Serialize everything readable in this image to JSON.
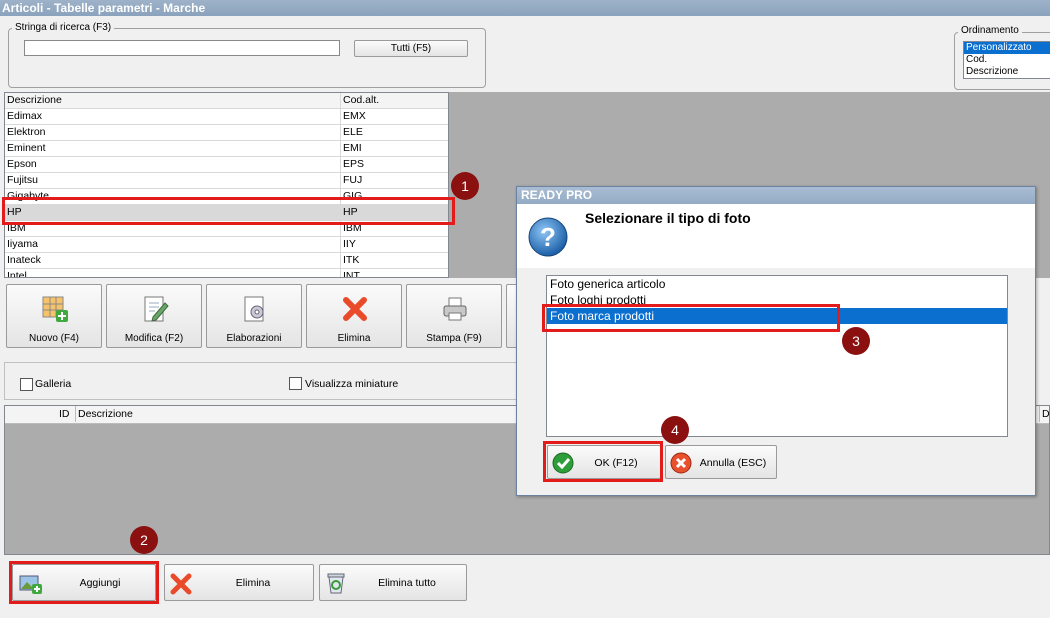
{
  "window": {
    "title": "Articoli - Tabelle parametri - Marche"
  },
  "search": {
    "legend": "Stringa di ricerca (F3)",
    "value": "",
    "all_button": "Tutti (F5)"
  },
  "ordering": {
    "legend": "Ordinamento",
    "options": [
      "Personalizzato",
      "Cod.",
      "Descrizione"
    ]
  },
  "brands": {
    "headers": [
      "Descrizione",
      "Cod.alt."
    ],
    "rows": [
      {
        "desc": "Edimax",
        "code": "EMX"
      },
      {
        "desc": "Elektron",
        "code": "ELE"
      },
      {
        "desc": "Eminent",
        "code": "EMI"
      },
      {
        "desc": "Epson",
        "code": "EPS"
      },
      {
        "desc": "Fujitsu",
        "code": "FUJ"
      },
      {
        "desc": "Gigabyte",
        "code": "GIG"
      },
      {
        "desc": "HP",
        "code": "HP"
      },
      {
        "desc": "IBM",
        "code": "IBM"
      },
      {
        "desc": "Iiyama",
        "code": "IIY"
      },
      {
        "desc": "Inateck",
        "code": "ITK"
      },
      {
        "desc": "Intel",
        "code": "INT"
      }
    ]
  },
  "toolbar": {
    "new": "Nuovo (F4)",
    "edit": "Modifica (F2)",
    "process": "Elaborazioni",
    "delete": "Elimina",
    "print": "Stampa (F9)"
  },
  "options": {
    "gallery": "Galleria",
    "thumbnails": "Visualizza miniature"
  },
  "photos": {
    "col_id": "ID",
    "col_desc": "Descrizione",
    "col_right": "Di"
  },
  "bottom": {
    "add": "Aggiungi",
    "delete": "Elimina",
    "delete_all": "Elimina tutto"
  },
  "dialog": {
    "title": "READY PRO",
    "heading": "Selezionare il tipo di foto",
    "options": [
      "Foto generica articolo",
      "Foto loghi prodotti",
      "Foto marca prodotti"
    ],
    "ok": "OK (F12)",
    "cancel": "Annulla (ESC)"
  },
  "markers": [
    "1",
    "2",
    "3",
    "4"
  ],
  "colors": {
    "selection": "#0b6fcf",
    "highlight_box": "#e31b1b",
    "marker": "#8b1010"
  }
}
